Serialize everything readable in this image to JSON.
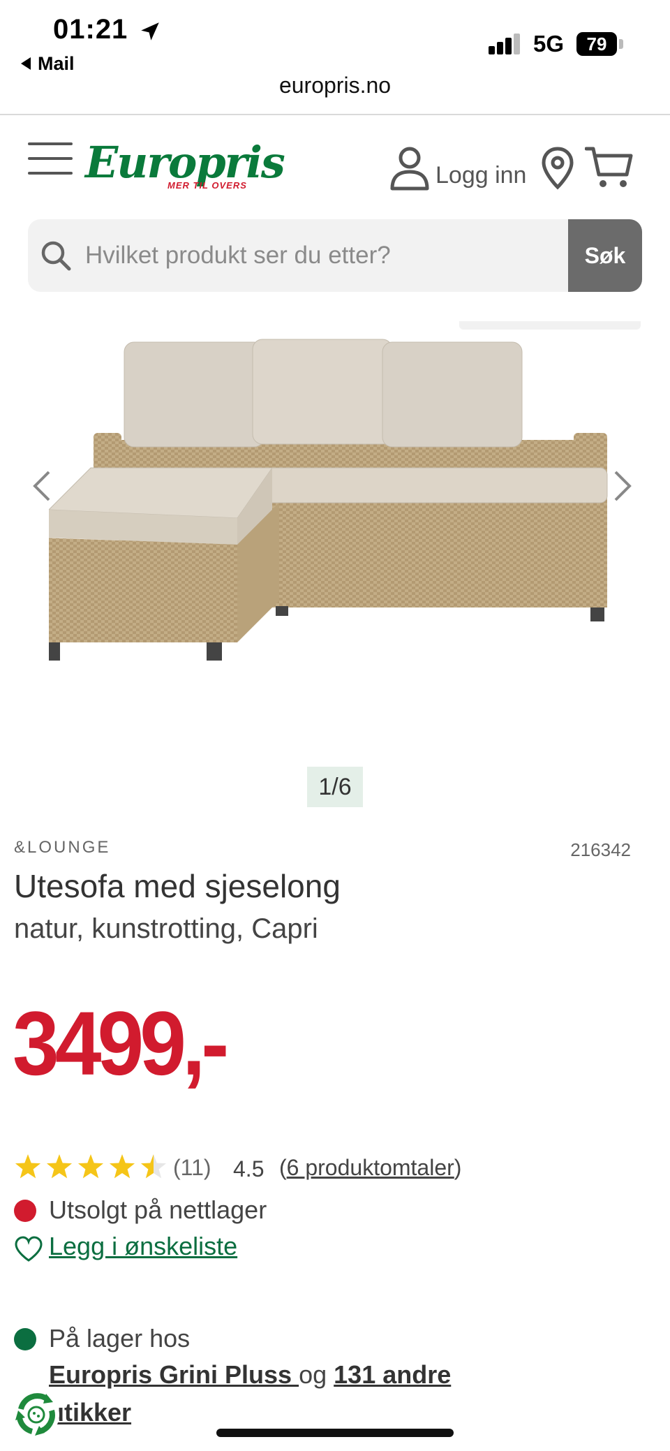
{
  "status_bar": {
    "time": "01:21",
    "back_app": "Mail",
    "network": "5G",
    "battery": "79",
    "url": "europris.no"
  },
  "header": {
    "logo_text": "Europris",
    "logo_tagline": "MER TIL OVERS",
    "login_label": "Logg inn",
    "icons": [
      "menu-icon",
      "user-icon",
      "location-pin-icon",
      "cart-icon"
    ]
  },
  "search": {
    "placeholder": "Hvilket produkt ser du etter?",
    "button_label": "Søk"
  },
  "gallery": {
    "counter": "1/6"
  },
  "product": {
    "brand": "&LOUNGE",
    "sku": "216342",
    "title": "Utesofa med sjeselong",
    "subtitle": "natur, kunstrotting, Capri",
    "price": "3499,-",
    "rating_value": 4.5,
    "rating_max": 5,
    "rating_count": "(11)",
    "rating_avg": "4.5",
    "reviews_prefix": "(",
    "reviews_link": "6 produktomtaler",
    "reviews_suffix": ")"
  },
  "availability": {
    "online_status": "Utsolgt på nettlager",
    "wishlist_label": "Legg i ønskeliste",
    "store_prefix": "På lager hos",
    "store_name": "Europris Grini Pluss ",
    "store_connector": "og",
    "store_others": "131 andre",
    "store_others_suffix": "utikker"
  },
  "colors": {
    "brand_green": "#0a7a3b",
    "price_red": "#d11b2e",
    "sold_out_red": "#d11b2e",
    "in_stock_green": "#0b6e40",
    "star_yellow": "#f5c518"
  }
}
